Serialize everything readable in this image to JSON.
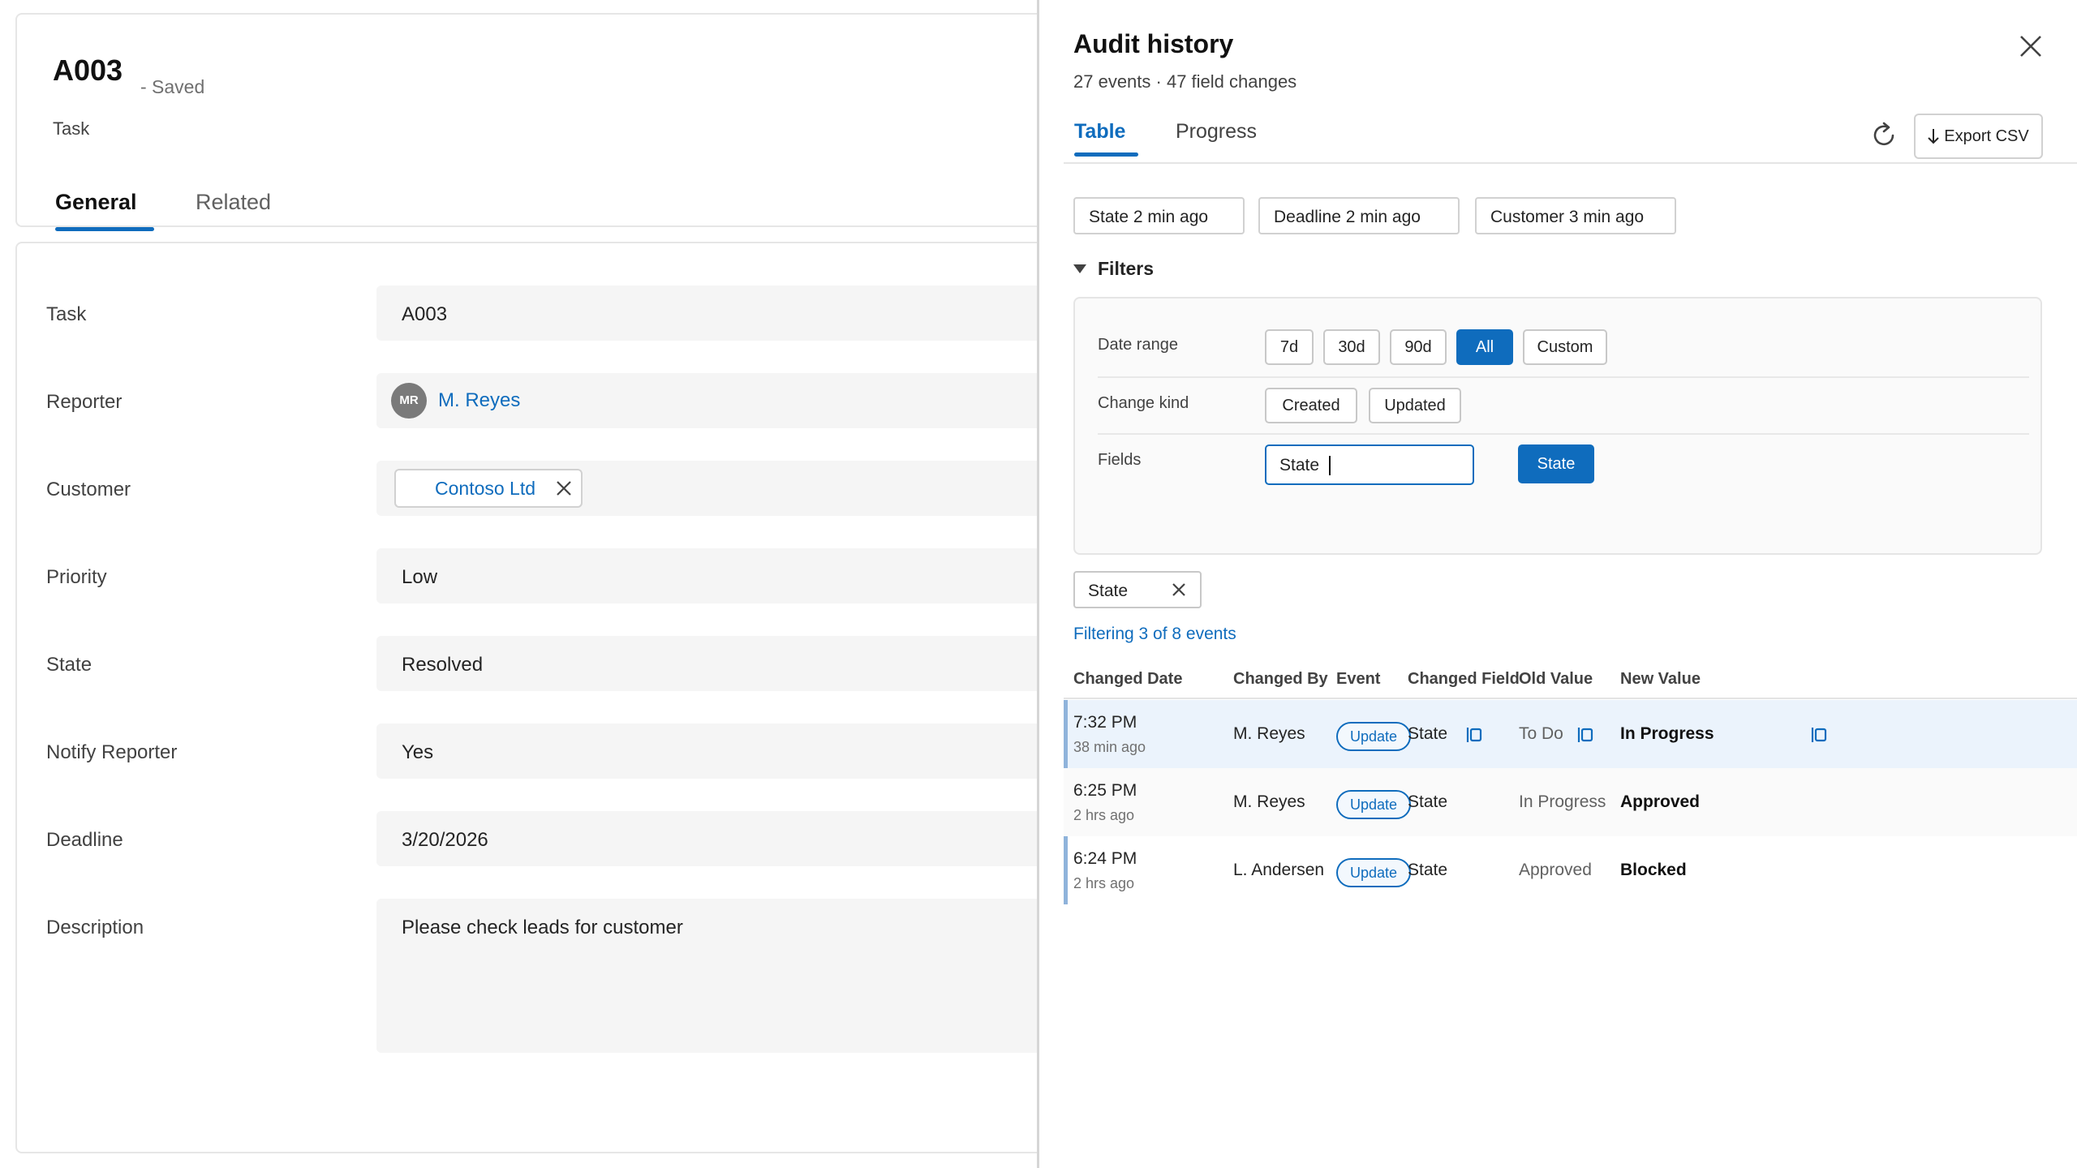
{
  "record": {
    "title": "A003",
    "status": "- Saved",
    "entity": "Task",
    "tabs": [
      "General",
      "Related"
    ]
  },
  "form": {
    "fields": [
      {
        "label": "Task",
        "value": "A003"
      },
      {
        "label": "Reporter",
        "value": "M. Reyes",
        "avatar_initials": "MR"
      },
      {
        "label": "Customer",
        "value": "Contoso Ltd"
      },
      {
        "label": "Priority",
        "value": "Low"
      },
      {
        "label": "State",
        "value": "Resolved"
      },
      {
        "label": "Notify Reporter",
        "value": "Yes"
      },
      {
        "label": "Deadline",
        "value": "3/20/2026"
      },
      {
        "label": "Description",
        "value": "Please check leads for customer"
      }
    ]
  },
  "panel": {
    "title": "Audit history",
    "subtitle": "27 events · 47 field changes",
    "tabs": [
      "Table",
      "Progress"
    ],
    "export_label": "Export CSV",
    "recent_chips": [
      "State 2 min ago",
      "Deadline 2 min ago",
      "Customer 3 min ago"
    ],
    "filters": {
      "toggle_label": "Filters",
      "date_range_label": "Date range",
      "date_options": [
        "7d",
        "30d",
        "90d",
        "All",
        "Custom"
      ],
      "date_selected": "All",
      "change_kind_label": "Change kind",
      "change_kind_options": [
        "Created",
        "Updated"
      ],
      "fields_label": "Fields",
      "fields_input_value": "State",
      "fields_suggestion": "State"
    },
    "applied_filter": "State",
    "filtering_count": "Filtering 3 of 8 events",
    "table": {
      "columns": [
        "Changed Date",
        "Changed By",
        "Event",
        "Changed Field",
        "Old Value",
        "New Value"
      ],
      "rows": [
        {
          "time": "7:32 PM",
          "ago": "38 min ago",
          "by": "M. Reyes",
          "event": "Update",
          "field": "State",
          "old": "To Do",
          "new": "In Progress"
        },
        {
          "time": "6:25 PM",
          "ago": "2 hrs ago",
          "by": "M. Reyes",
          "event": "Update",
          "field": "State",
          "old": "In Progress",
          "new": "Approved"
        },
        {
          "time": "6:24 PM",
          "ago": "2 hrs ago",
          "by": "L. Andersen",
          "event": "Update",
          "field": "State",
          "old": "Approved",
          "new": "Blocked"
        }
      ]
    }
  },
  "colors": {
    "accent": "#0f6cbd",
    "selected_row": "#ebf3fc"
  }
}
